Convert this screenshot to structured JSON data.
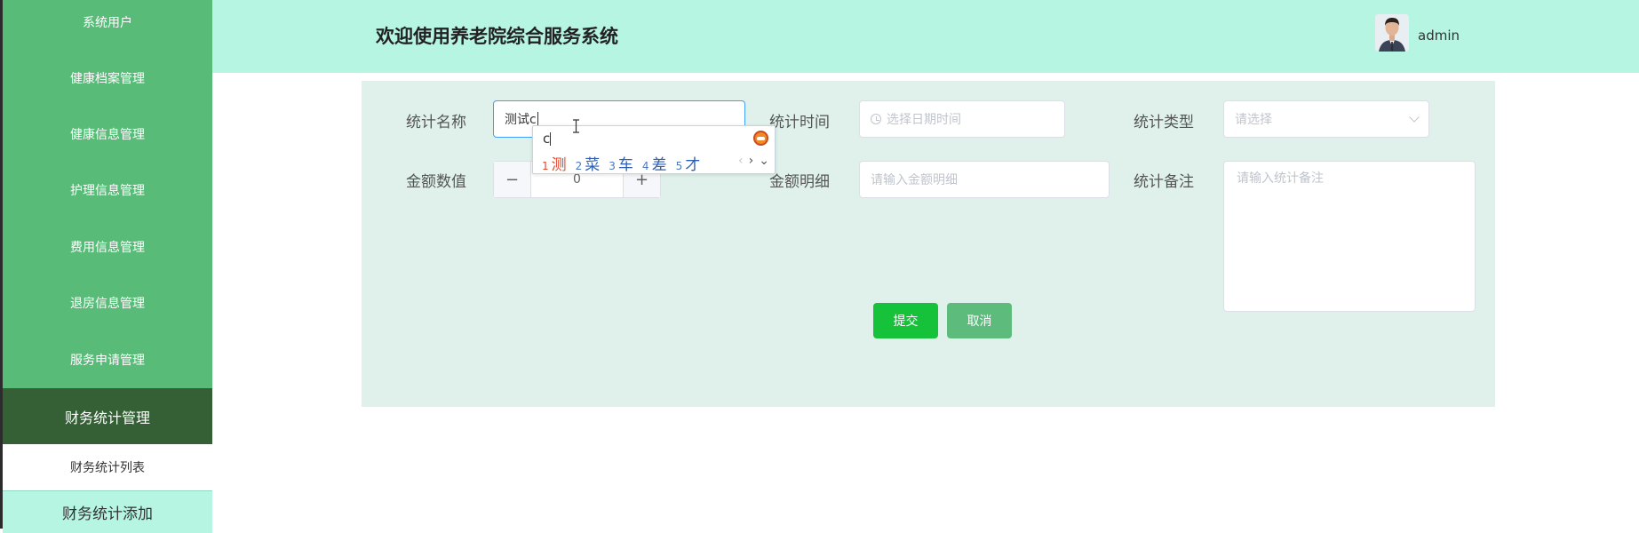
{
  "sidebar": {
    "items": [
      {
        "label": "系统用户"
      },
      {
        "label": "健康档案管理"
      },
      {
        "label": "健康信息管理"
      },
      {
        "label": "护理信息管理"
      },
      {
        "label": "费用信息管理"
      },
      {
        "label": "退房信息管理"
      },
      {
        "label": "服务申请管理"
      },
      {
        "label": "财务统计管理"
      }
    ],
    "subitems": [
      {
        "label": "财务统计列表"
      },
      {
        "label": "财务统计添加"
      }
    ]
  },
  "header": {
    "title": "欢迎使用养老院综合服务系统",
    "username": "admin"
  },
  "form": {
    "name_label": "统计名称",
    "name_value": "测试c",
    "time_label": "统计时间",
    "time_placeholder": "选择日期时间",
    "type_label": "统计类型",
    "type_placeholder": "请选择",
    "amount_label": "金额数值",
    "amount_value": "0",
    "amount_minus": "−",
    "amount_plus": "+",
    "detail_label": "金额明细",
    "detail_placeholder": "请输入金额明细",
    "remark_label": "统计备注",
    "remark_placeholder": "请输入统计备注",
    "submit_label": "提交",
    "cancel_label": "取消"
  },
  "ime": {
    "composition": "c",
    "candidates": [
      {
        "num": "1",
        "text": "测"
      },
      {
        "num": "2",
        "text": "菜"
      },
      {
        "num": "3",
        "text": "车"
      },
      {
        "num": "4",
        "text": "差"
      },
      {
        "num": "5",
        "text": "才"
      }
    ],
    "prev": "‹",
    "next": "›",
    "expand": "⌄"
  },
  "colors": {
    "sidebar_bg": "#58bc78",
    "sidebar_active": "#356036",
    "header_bg": "#b7f5e3",
    "panel_bg": "#dff1ea",
    "submit": "#16c23a",
    "cancel": "#5dbc7c",
    "focus": "#409eff"
  }
}
